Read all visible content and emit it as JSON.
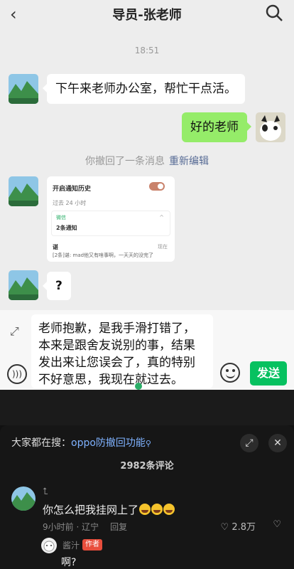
{
  "header": {
    "back_icon": "chevron-left-icon",
    "title": "导员-张老师",
    "search_icon": "search-icon"
  },
  "chat": {
    "timestamp": "18:51",
    "msg1": "下午来老师办公室，帮忙干点活。",
    "msg2": "好的老师",
    "recall_text": "你撤回了一条消息",
    "recall_edit": "重新编辑",
    "screenshot": {
      "title": "开启通知历史",
      "past": "过去 24 小时",
      "app": "微信",
      "count": "2条通知",
      "sender": "谌",
      "preview": "[2条]谌: mad他又有啥事啊，一天天的没完了",
      "when": "现在"
    },
    "msg3": "?"
  },
  "input": {
    "text": "老师抱歉，是我手滑打错了，本来是跟舍友说别的事，结果发出来让您误会了，真的特别不好意思，我现在就过去。",
    "send_label": "发送"
  },
  "comments": {
    "search_prefix": "大家都在搜：",
    "search_keyword": "oppo防撤回功能",
    "count_label": "2982条评论",
    "top": {
      "name": "⮤",
      "text": "你怎么把我挂网上了",
      "meta": "9小时前 · 辽宁",
      "reply": "回复",
      "likes": "2.8万"
    },
    "sub": {
      "name": "酱汁",
      "tag": "作者",
      "text": "啊?"
    }
  },
  "colors": {
    "wechat_green": "#95ec69",
    "send_green": "#07c160",
    "link_blue": "#576b95",
    "author_red": "#e84e3c"
  }
}
